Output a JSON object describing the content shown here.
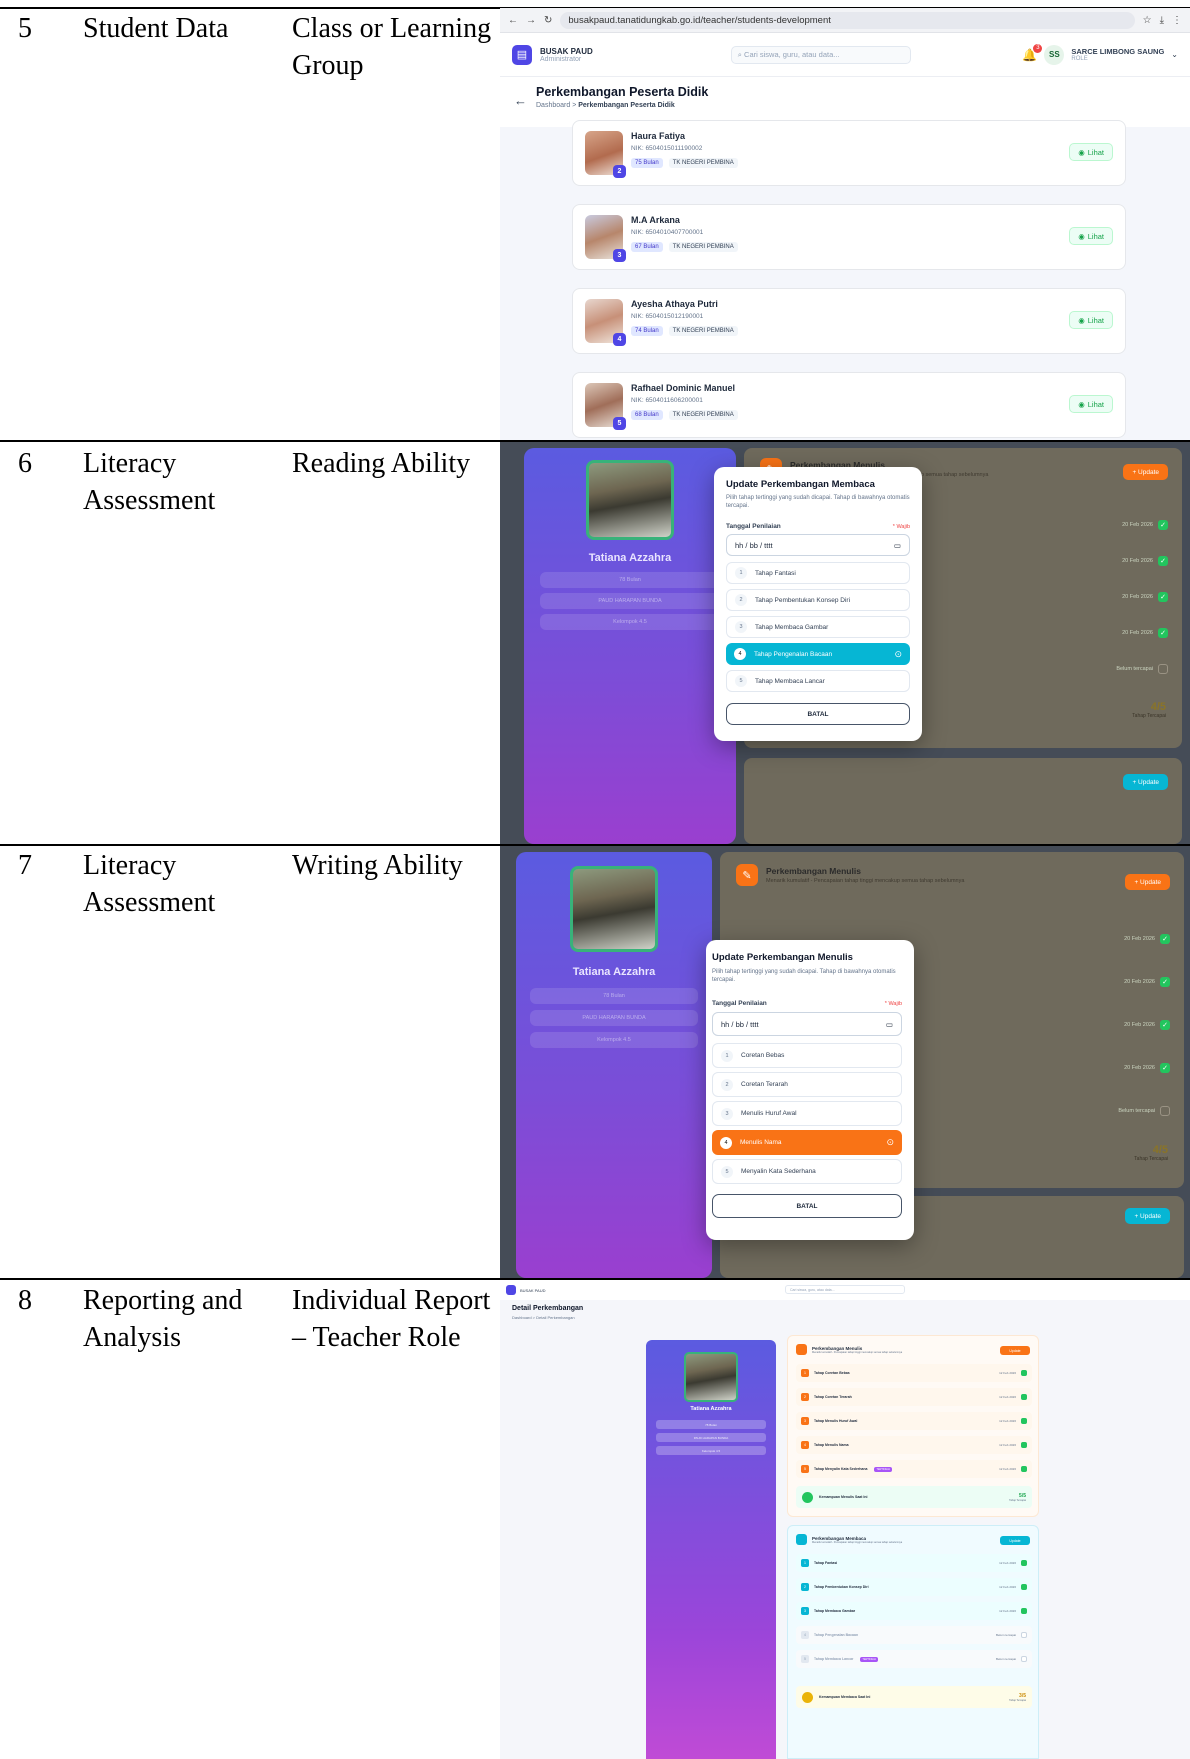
{
  "rows": [
    {
      "no": "5",
      "feature": "Student Data",
      "sub": "Class or Learning Group"
    },
    {
      "no": "6",
      "feature": "Literacy Assessment",
      "sub": "Reading Ability"
    },
    {
      "no": "7",
      "feature": "Literacy Assessment",
      "sub": "Writing Ability"
    },
    {
      "no": "8",
      "feature": "Reporting and Analysis",
      "sub": "Individual Report – Teacher Role"
    }
  ],
  "shot1": {
    "url": "busakpaud.tanatidungkab.go.id/teacher/students-development",
    "brand": "BUSAK PAUD",
    "brand_sub": "Administrator",
    "search_placeholder": "Cari siswa, guru, atau data...",
    "notif_count": "3",
    "user_initials": "SS",
    "user_name": "SARCE LIMBONG SAUNG",
    "user_role": "ROLE",
    "page_title": "Perkembangan Peserta Didik",
    "bc_home": "Dashboard",
    "bc_sep": ">",
    "bc_current": "Perkembangan Peserta Didik",
    "view_label": "Lihat",
    "students": [
      {
        "idx": "2",
        "name": "Haura Fatiya",
        "nik": "NIK: 6504015011190002",
        "age": "75 Bulan",
        "school": "TK NEGERI PEMBINA"
      },
      {
        "idx": "3",
        "name": "M.A Arkana",
        "nik": "NIK: 6504010407700001",
        "age": "67 Bulan",
        "school": "TK NEGERI PEMBINA"
      },
      {
        "idx": "4",
        "name": "Ayesha Athaya Putri",
        "nik": "NIK: 6504015012190001",
        "age": "74 Bulan",
        "school": "TK NEGERI PEMBINA"
      },
      {
        "idx": "5",
        "name": "Rafhael Dominic Manuel",
        "nik": "NIK: 6504011606200001",
        "age": "68 Bulan",
        "school": "TK NEGERI PEMBINA"
      }
    ]
  },
  "profile": {
    "name": "Tatiana Azzahra",
    "age": "78 Bulan",
    "school": "PAUD HARAPAN BUNDA",
    "group": "Kelompok 4.5"
  },
  "shot2": {
    "panel_title": "Perkembangan Menulis",
    "panel_sub": "Menarik kumulatif - Pencapaian tahap tinggi mencakup semua tahap sebelumnya",
    "update_label": "+ Update",
    "dates": [
      "20 Feb 2026",
      "20 Feb 2026",
      "20 Feb 2026",
      "20 Feb 2026"
    ],
    "pending": "Belum tercapai",
    "score": "4/5",
    "score_label": "Tahap Tercapai",
    "modal_title": "Update Perkembangan Membaca",
    "modal_desc": "Pilih tahap tertinggi yang sudah dicapai. Tahap di bawahnya otomatis tercapai.",
    "date_label": "Tanggal Penilaian",
    "required": "* Wajib",
    "date_placeholder": "hh / bb / tttt",
    "options": [
      "Tahap Fantasi",
      "Tahap Pembentukan Konsep Diri",
      "Tahap Membaca Gambar",
      "Tahap Pengenalan Bacaan",
      "Tahap Membaca Lancar"
    ],
    "cancel": "BATAL",
    "selected_color": "#06b6d4"
  },
  "shot3": {
    "panel_title": "Perkembangan Menulis",
    "panel_sub": "Menarik kumulatif - Pencapaian tahap tinggi mencakup semua tahap sebelumnya",
    "update_label": "+ Update",
    "dates": [
      "20 Feb 2026",
      "20 Feb 2026",
      "20 Feb 2026",
      "20 Feb 2026"
    ],
    "pending": "Belum tercapai",
    "score": "4/5",
    "score_label": "Tahap Tercapai",
    "modal_title": "Update Perkembangan Menulis",
    "modal_desc": "Pilih tahap tertinggi yang sudah dicapai. Tahap di bawahnya otomatis tercapai.",
    "date_label": "Tanggal Penilaian",
    "required": "* Wajib",
    "date_placeholder": "hh / bb / tttt",
    "options": [
      "Coretan Bebas",
      "Coretan Terarah",
      "Menulis Huruf Awal",
      "Menulis Nama",
      "Menyalin Kata Sederhana"
    ],
    "cancel": "BATAL",
    "selected_color": "#f97316"
  },
  "shot4": {
    "brand": "BUSAK PAUD",
    "search_placeholder": "Cari siswa, guru, atau data...",
    "title": "Detail Perkembangan",
    "breadcrumb": "Dashboard > Detail Perkembangan",
    "writing": {
      "title": "Perkembangan Menulis",
      "sub": "Menarik kumulatif - Pencapaian tahap tinggi mencakup semua tahap sebelumnya",
      "update": "Update",
      "items": [
        {
          "n": "1",
          "t": "Tahap Coretan Bebas",
          "d": "12 Feb 2026"
        },
        {
          "n": "2",
          "t": "Tahap Coretan Terarah",
          "d": "12 Feb 2026"
        },
        {
          "n": "3",
          "t": "Tahap Menulis Huruf Awal",
          "d": "12 Feb 2026"
        },
        {
          "n": "4",
          "t": "Tahap Menulis Nama",
          "d": "12 Feb 2026"
        },
        {
          "n": "5",
          "t": "Tahap Menyalin Kata Sederhana",
          "d": "12 Feb 2026",
          "tag": "TERTINGGI"
        }
      ],
      "summary": "Kemampuan Menulis Saat Ini",
      "score": "5/5",
      "score_label": "Tahap Tercapai"
    },
    "reading": {
      "title": "Perkembangan Membaca",
      "sub": "Menarik kumulatif - Pencapaian tahap tinggi mencakup semua tahap sebelumnya",
      "update": "Update",
      "items": [
        {
          "n": "1",
          "t": "Tahap Fantasi",
          "d": "12 Feb 2026"
        },
        {
          "n": "2",
          "t": "Tahap Pembentukan Konsep Diri",
          "d": "12 Feb 2026"
        },
        {
          "n": "3",
          "t": "Tahap Membaca Gambar",
          "d": "12 Feb 2026"
        },
        {
          "n": "4",
          "t": "Tahap Pengenalan Bacaan",
          "d": "Belum tercapai"
        },
        {
          "n": "5",
          "t": "Tahap Membaca Lancar",
          "d": "Belum tercapai",
          "tag": "TERTINGGI"
        }
      ],
      "summary": "Kemampuan Membaca Saat Ini",
      "score": "3/5",
      "score_label": "Tahap Tercapai"
    }
  }
}
